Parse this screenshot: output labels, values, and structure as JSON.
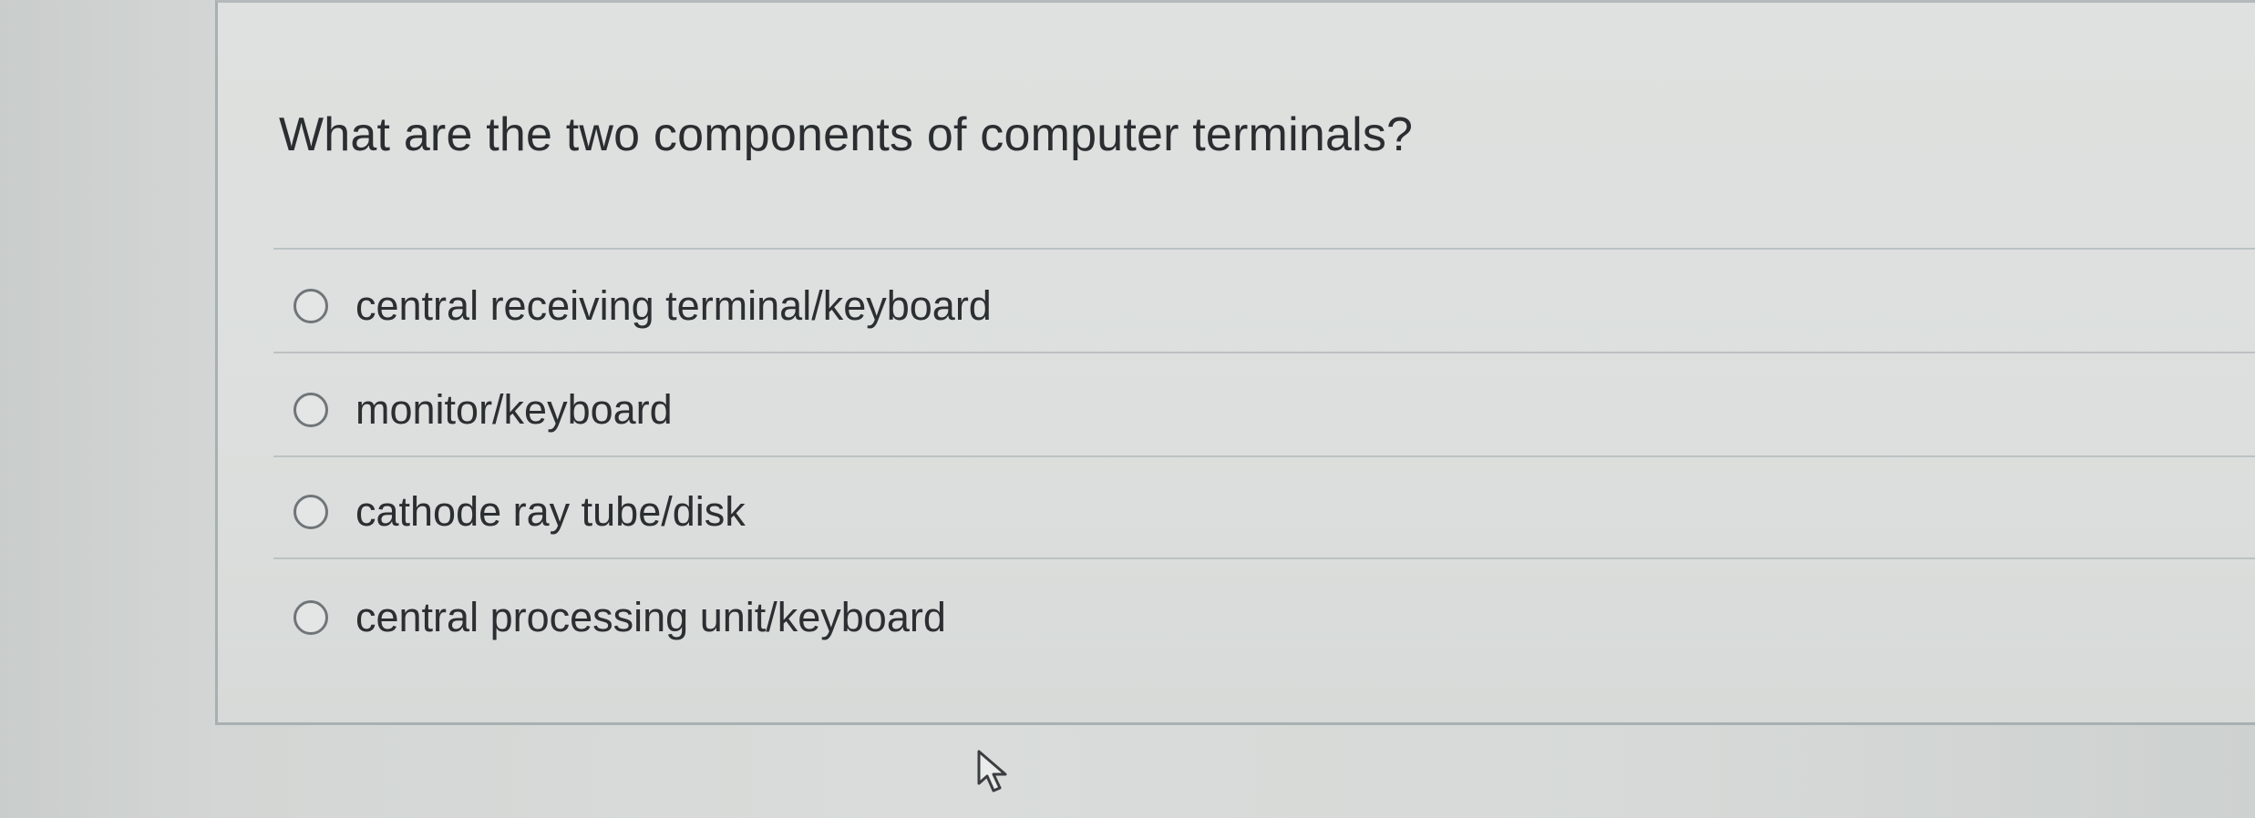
{
  "question": {
    "text": "What are the two components of computer terminals?"
  },
  "answers": [
    {
      "label": "central receiving terminal/keyboard",
      "selected": false
    },
    {
      "label": "monitor/keyboard",
      "selected": false
    },
    {
      "label": "cathode ray tube/disk",
      "selected": false
    },
    {
      "label": "central processing unit/keyboard",
      "selected": false
    }
  ],
  "icons": {
    "radio": "radio-unchecked-icon",
    "cursor": "mouse-pointer-icon"
  },
  "colors": {
    "text": "#2a2e30",
    "radio_border": "#6f7578",
    "divider": "#bcc2c3"
  }
}
